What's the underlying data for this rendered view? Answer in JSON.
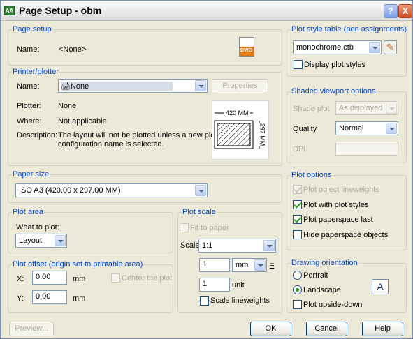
{
  "title": "Page Setup - obm",
  "title_icon": "AA",
  "help_label": "?",
  "close_label": "X",
  "page_setup": {
    "group": "Page setup",
    "name_label": "Name:",
    "name_value": "<None>",
    "dwg_label": "DWG"
  },
  "printer": {
    "group": "Printer/plotter",
    "name_label": "Name:",
    "selected": "None",
    "properties_label": "Properties",
    "plotter_label": "Plotter:",
    "plotter_value": "None",
    "where_label": "Where:",
    "where_value": "Not applicable",
    "description_label": "Description:",
    "description_line1": "The layout will not be plotted unless a new plotter",
    "description_line2": "configuration name is selected.",
    "preview_width": "420 MM",
    "preview_height": "297 MM"
  },
  "paper_size": {
    "group": "Paper size",
    "selected": "ISO A3 (420.00 x 297.00 MM)"
  },
  "plot_area": {
    "group": "Plot area",
    "what_label": "What to plot:",
    "selected": "Layout"
  },
  "plot_offset": {
    "group": "Plot offset (origin set to printable area)",
    "x_label": "X:",
    "x_value": "0.00",
    "y_label": "Y:",
    "y_value": "0.00",
    "unit": "mm",
    "center_label": "Center the plot"
  },
  "plot_scale": {
    "group": "Plot scale",
    "fit_label": "Fit to paper",
    "scale_label": "Scale:",
    "scale_value": "1:1",
    "num_value": "1",
    "unit_select": "mm",
    "equals": "=",
    "den_value": "1",
    "den_unit": "unit",
    "lineweights_label": "Scale lineweights"
  },
  "plot_style_table": {
    "group": "Plot style table (pen assignments)",
    "selected": "monochrome.ctb",
    "display_label": "Display plot styles"
  },
  "shaded_viewport": {
    "group": "Shaded viewport options",
    "shade_label": "Shade plot",
    "shade_value": "As displayed",
    "quality_label": "Quality",
    "quality_value": "Normal",
    "dpi_label": "DPI"
  },
  "plot_options": {
    "group": "Plot options",
    "items": [
      "Plot object lineweights",
      "Plot with plot styles",
      "Plot paperspace last",
      "Hide paperspace objects"
    ]
  },
  "orientation": {
    "group": "Drawing orientation",
    "portrait": "Portrait",
    "landscape": "Landscape",
    "upside_down": "Plot upside-down",
    "icon_letter": "A"
  },
  "buttons": {
    "preview": "Preview...",
    "ok": "OK",
    "cancel": "Cancel",
    "help": "Help"
  }
}
